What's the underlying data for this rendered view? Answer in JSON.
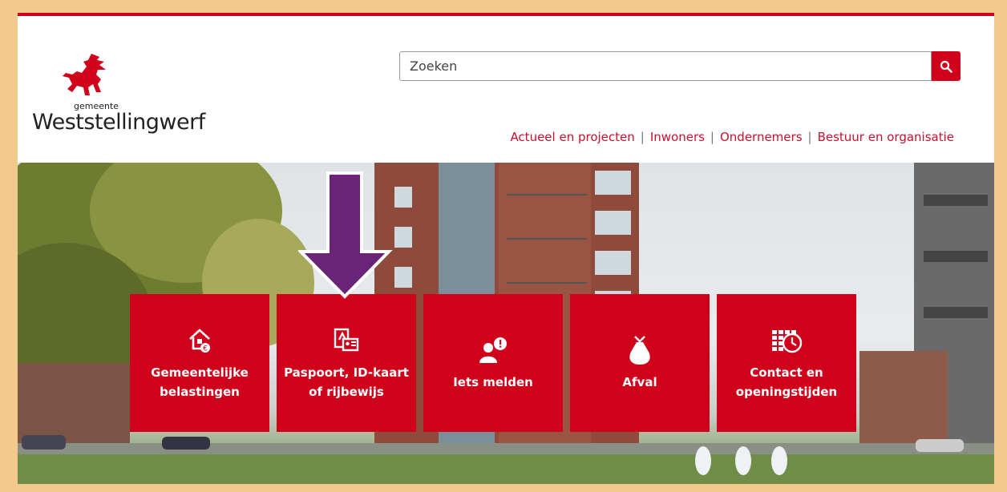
{
  "header": {
    "logo_small": "gemeente",
    "logo_name": "Weststellingwerf"
  },
  "search": {
    "placeholder": "Zoeken"
  },
  "nav": {
    "items": [
      "Actueel en projecten",
      "Inwoners",
      "Ondernemers",
      "Bestuur en organisatie"
    ],
    "separator": "|"
  },
  "tiles": [
    {
      "label": "Gemeentelijke belastingen",
      "icon": "house-euro-icon"
    },
    {
      "label": "Paspoort, ID-kaart of rijbewijs",
      "icon": "id-card-icon"
    },
    {
      "label": "Iets melden",
      "icon": "person-alert-icon"
    },
    {
      "label": "Afval",
      "icon": "waste-bag-icon"
    },
    {
      "label": "Contact en openingstijden",
      "icon": "calendar-clock-icon"
    }
  ],
  "colors": {
    "brand": "#d0021b",
    "arrow": "#6b2377",
    "frame": "#f3c98e"
  }
}
